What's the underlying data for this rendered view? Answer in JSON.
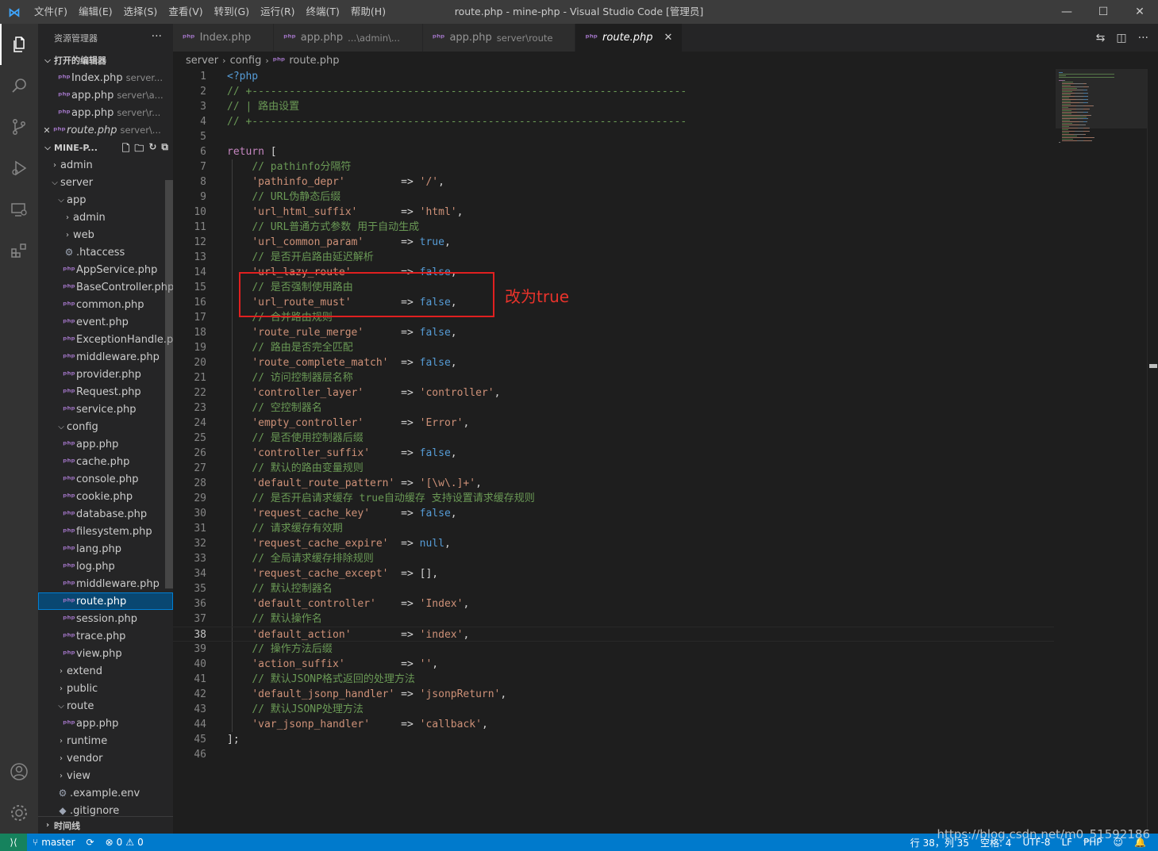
{
  "titlebar": {
    "menu": [
      "文件(F)",
      "编辑(E)",
      "选择(S)",
      "查看(V)",
      "转到(G)",
      "运行(R)",
      "终端(T)",
      "帮助(H)"
    ],
    "title": "route.php - mine-php - Visual Studio Code [管理员]"
  },
  "sidebar": {
    "header": "资源管理器",
    "open_editors_label": "打开的编辑器",
    "open_editors": [
      {
        "name": "Index.php",
        "desc": "server...",
        "active": false
      },
      {
        "name": "app.php",
        "desc": "server\\a...",
        "active": false
      },
      {
        "name": "app.php",
        "desc": "server\\r...",
        "active": false
      },
      {
        "name": "route.php",
        "desc": "server\\...",
        "active": true
      }
    ],
    "project_label": "MINE-P...",
    "tree": [
      {
        "depth": 0,
        "type": "folder",
        "open": false,
        "name": "admin"
      },
      {
        "depth": 0,
        "type": "folder",
        "open": true,
        "name": "server"
      },
      {
        "depth": 1,
        "type": "folder",
        "open": true,
        "name": "app"
      },
      {
        "depth": 2,
        "type": "folder",
        "open": false,
        "name": "admin"
      },
      {
        "depth": 2,
        "type": "folder",
        "open": false,
        "name": "web"
      },
      {
        "depth": 2,
        "type": "gear",
        "name": ".htaccess"
      },
      {
        "depth": 2,
        "type": "php",
        "name": "AppService.php"
      },
      {
        "depth": 2,
        "type": "php",
        "name": "BaseController.php"
      },
      {
        "depth": 2,
        "type": "php",
        "name": "common.php"
      },
      {
        "depth": 2,
        "type": "php",
        "name": "event.php"
      },
      {
        "depth": 2,
        "type": "php",
        "name": "ExceptionHandle.p..."
      },
      {
        "depth": 2,
        "type": "php",
        "name": "middleware.php"
      },
      {
        "depth": 2,
        "type": "php",
        "name": "provider.php"
      },
      {
        "depth": 2,
        "type": "php",
        "name": "Request.php"
      },
      {
        "depth": 2,
        "type": "php",
        "name": "service.php"
      },
      {
        "depth": 1,
        "type": "folder",
        "open": true,
        "name": "config"
      },
      {
        "depth": 2,
        "type": "php",
        "name": "app.php"
      },
      {
        "depth": 2,
        "type": "php",
        "name": "cache.php"
      },
      {
        "depth": 2,
        "type": "php",
        "name": "console.php"
      },
      {
        "depth": 2,
        "type": "php",
        "name": "cookie.php"
      },
      {
        "depth": 2,
        "type": "php",
        "name": "database.php"
      },
      {
        "depth": 2,
        "type": "php",
        "name": "filesystem.php"
      },
      {
        "depth": 2,
        "type": "php",
        "name": "lang.php"
      },
      {
        "depth": 2,
        "type": "php",
        "name": "log.php"
      },
      {
        "depth": 2,
        "type": "php",
        "name": "middleware.php"
      },
      {
        "depth": 2,
        "type": "php",
        "name": "route.php",
        "selected": true
      },
      {
        "depth": 2,
        "type": "php",
        "name": "session.php"
      },
      {
        "depth": 2,
        "type": "php",
        "name": "trace.php"
      },
      {
        "depth": 2,
        "type": "php",
        "name": "view.php"
      },
      {
        "depth": 1,
        "type": "folder",
        "open": false,
        "name": "extend"
      },
      {
        "depth": 1,
        "type": "folder",
        "open": false,
        "name": "public"
      },
      {
        "depth": 1,
        "type": "folder",
        "open": true,
        "name": "route"
      },
      {
        "depth": 2,
        "type": "php",
        "name": "app.php"
      },
      {
        "depth": 1,
        "type": "folder",
        "open": false,
        "name": "runtime"
      },
      {
        "depth": 1,
        "type": "folder",
        "open": false,
        "name": "vendor"
      },
      {
        "depth": 1,
        "type": "folder",
        "open": false,
        "name": "view"
      },
      {
        "depth": 1,
        "type": "gear",
        "name": ".example.env"
      },
      {
        "depth": 1,
        "type": "dot",
        "name": ".gitignore"
      }
    ],
    "timeline_label": "时间线"
  },
  "tabs": [
    {
      "name": "Index.php",
      "desc": "",
      "active": false
    },
    {
      "name": "app.php",
      "desc": "...\\admin\\...",
      "active": false
    },
    {
      "name": "app.php",
      "desc": "server\\route",
      "active": false
    },
    {
      "name": "route.php",
      "desc": "",
      "active": true
    }
  ],
  "breadcrumb": [
    "server",
    "config",
    "route.php"
  ],
  "editor": {
    "current_line": 38,
    "lines": [
      [
        [
          "c-tag",
          "<?php"
        ]
      ],
      [
        [
          "c-cm",
          "// +----------------------------------------------------------------------"
        ]
      ],
      [
        [
          "c-cm",
          "// | 路由设置"
        ]
      ],
      [
        [
          "c-cm",
          "// +----------------------------------------------------------------------"
        ]
      ],
      [],
      [
        [
          "c-kw",
          "return"
        ],
        [
          "c-pl",
          " ["
        ]
      ],
      [
        [
          "c-pl",
          "    "
        ],
        [
          "c-cm",
          "// pathinfo分隔符"
        ]
      ],
      [
        [
          "c-pl",
          "    "
        ],
        [
          "c-str",
          "'pathinfo_depr'"
        ],
        [
          "c-pl",
          "         => "
        ],
        [
          "c-str",
          "'/'"
        ],
        [
          "c-pl",
          ","
        ]
      ],
      [
        [
          "c-pl",
          "    "
        ],
        [
          "c-cm",
          "// URL伪静态后缀"
        ]
      ],
      [
        [
          "c-pl",
          "    "
        ],
        [
          "c-str",
          "'url_html_suffix'"
        ],
        [
          "c-pl",
          "       => "
        ],
        [
          "c-str",
          "'html'"
        ],
        [
          "c-pl",
          ","
        ]
      ],
      [
        [
          "c-pl",
          "    "
        ],
        [
          "c-cm",
          "// URL普通方式参数 用于自动生成"
        ]
      ],
      [
        [
          "c-pl",
          "    "
        ],
        [
          "c-str",
          "'url_common_param'"
        ],
        [
          "c-pl",
          "      => "
        ],
        [
          "c-bool",
          "true"
        ],
        [
          "c-pl",
          ","
        ]
      ],
      [
        [
          "c-pl",
          "    "
        ],
        [
          "c-cm",
          "// 是否开启路由延迟解析"
        ]
      ],
      [
        [
          "c-pl",
          "    "
        ],
        [
          "c-str",
          "'url_lazy_route'"
        ],
        [
          "c-pl",
          "        => "
        ],
        [
          "c-bool",
          "false"
        ],
        [
          "c-pl",
          ","
        ]
      ],
      [
        [
          "c-pl",
          "    "
        ],
        [
          "c-cm",
          "// 是否强制使用路由"
        ]
      ],
      [
        [
          "c-pl",
          "    "
        ],
        [
          "c-str",
          "'url_route_must'"
        ],
        [
          "c-pl",
          "        => "
        ],
        [
          "c-bool",
          "false"
        ],
        [
          "c-pl",
          ","
        ]
      ],
      [
        [
          "c-pl",
          "    "
        ],
        [
          "c-cm",
          "// 合并路由规则"
        ]
      ],
      [
        [
          "c-pl",
          "    "
        ],
        [
          "c-str",
          "'route_rule_merge'"
        ],
        [
          "c-pl",
          "      => "
        ],
        [
          "c-bool",
          "false"
        ],
        [
          "c-pl",
          ","
        ]
      ],
      [
        [
          "c-pl",
          "    "
        ],
        [
          "c-cm",
          "// 路由是否完全匹配"
        ]
      ],
      [
        [
          "c-pl",
          "    "
        ],
        [
          "c-str",
          "'route_complete_match'"
        ],
        [
          "c-pl",
          "  => "
        ],
        [
          "c-bool",
          "false"
        ],
        [
          "c-pl",
          ","
        ]
      ],
      [
        [
          "c-pl",
          "    "
        ],
        [
          "c-cm",
          "// 访问控制器层名称"
        ]
      ],
      [
        [
          "c-pl",
          "    "
        ],
        [
          "c-str",
          "'controller_layer'"
        ],
        [
          "c-pl",
          "      => "
        ],
        [
          "c-str",
          "'controller'"
        ],
        [
          "c-pl",
          ","
        ]
      ],
      [
        [
          "c-pl",
          "    "
        ],
        [
          "c-cm",
          "// 空控制器名"
        ]
      ],
      [
        [
          "c-pl",
          "    "
        ],
        [
          "c-str",
          "'empty_controller'"
        ],
        [
          "c-pl",
          "      => "
        ],
        [
          "c-str",
          "'Error'"
        ],
        [
          "c-pl",
          ","
        ]
      ],
      [
        [
          "c-pl",
          "    "
        ],
        [
          "c-cm",
          "// 是否使用控制器后缀"
        ]
      ],
      [
        [
          "c-pl",
          "    "
        ],
        [
          "c-str",
          "'controller_suffix'"
        ],
        [
          "c-pl",
          "     => "
        ],
        [
          "c-bool",
          "false"
        ],
        [
          "c-pl",
          ","
        ]
      ],
      [
        [
          "c-pl",
          "    "
        ],
        [
          "c-cm",
          "// 默认的路由变量规则"
        ]
      ],
      [
        [
          "c-pl",
          "    "
        ],
        [
          "c-str",
          "'default_route_pattern'"
        ],
        [
          "c-pl",
          " => "
        ],
        [
          "c-str",
          "'[\\w\\.]+'"
        ],
        [
          "c-pl",
          ","
        ]
      ],
      [
        [
          "c-pl",
          "    "
        ],
        [
          "c-cm",
          "// 是否开启请求缓存 true自动缓存 支持设置请求缓存规则"
        ]
      ],
      [
        [
          "c-pl",
          "    "
        ],
        [
          "c-str",
          "'request_cache_key'"
        ],
        [
          "c-pl",
          "     => "
        ],
        [
          "c-bool",
          "false"
        ],
        [
          "c-pl",
          ","
        ]
      ],
      [
        [
          "c-pl",
          "    "
        ],
        [
          "c-cm",
          "// 请求缓存有效期"
        ]
      ],
      [
        [
          "c-pl",
          "    "
        ],
        [
          "c-str",
          "'request_cache_expire'"
        ],
        [
          "c-pl",
          "  => "
        ],
        [
          "c-bool",
          "null"
        ],
        [
          "c-pl",
          ","
        ]
      ],
      [
        [
          "c-pl",
          "    "
        ],
        [
          "c-cm",
          "// 全局请求缓存排除规则"
        ]
      ],
      [
        [
          "c-pl",
          "    "
        ],
        [
          "c-str",
          "'request_cache_except'"
        ],
        [
          "c-pl",
          "  => [],"
        ]
      ],
      [
        [
          "c-pl",
          "    "
        ],
        [
          "c-cm",
          "// 默认控制器名"
        ]
      ],
      [
        [
          "c-pl",
          "    "
        ],
        [
          "c-str",
          "'default_controller'"
        ],
        [
          "c-pl",
          "    => "
        ],
        [
          "c-str",
          "'Index'"
        ],
        [
          "c-pl",
          ","
        ]
      ],
      [
        [
          "c-pl",
          "    "
        ],
        [
          "c-cm",
          "// 默认操作名"
        ]
      ],
      [
        [
          "c-pl",
          "    "
        ],
        [
          "c-str",
          "'default_action'"
        ],
        [
          "c-pl",
          "        => "
        ],
        [
          "c-str",
          "'index'"
        ],
        [
          "c-pl",
          ","
        ]
      ],
      [
        [
          "c-pl",
          "    "
        ],
        [
          "c-cm",
          "// 操作方法后缀"
        ]
      ],
      [
        [
          "c-pl",
          "    "
        ],
        [
          "c-str",
          "'action_suffix'"
        ],
        [
          "c-pl",
          "         => "
        ],
        [
          "c-str",
          "''"
        ],
        [
          "c-pl",
          ","
        ]
      ],
      [
        [
          "c-pl",
          "    "
        ],
        [
          "c-cm",
          "// 默认JSONP格式返回的处理方法"
        ]
      ],
      [
        [
          "c-pl",
          "    "
        ],
        [
          "c-str",
          "'default_jsonp_handler'"
        ],
        [
          "c-pl",
          " => "
        ],
        [
          "c-str",
          "'jsonpReturn'"
        ],
        [
          "c-pl",
          ","
        ]
      ],
      [
        [
          "c-pl",
          "    "
        ],
        [
          "c-cm",
          "// 默认JSONP处理方法"
        ]
      ],
      [
        [
          "c-pl",
          "    "
        ],
        [
          "c-str",
          "'var_jsonp_handler'"
        ],
        [
          "c-pl",
          "     => "
        ],
        [
          "c-str",
          "'callback'"
        ],
        [
          "c-pl",
          ","
        ]
      ],
      [
        [
          "c-pl",
          "];"
        ]
      ],
      []
    ]
  },
  "annotation": {
    "text": "改为true",
    "color": "#e8332b"
  },
  "statusbar": {
    "branch": "master",
    "errors": "0",
    "warnings": "0",
    "position": "行 38，列 35",
    "spaces": "空格: 4",
    "encoding": "UTF-8",
    "eol": "LF",
    "language": "PHP"
  },
  "watermark": "https://blog.csdn.net/m0_51592186",
  "colors": {
    "accent": "#007acc",
    "php_icon": "#a074c4"
  }
}
